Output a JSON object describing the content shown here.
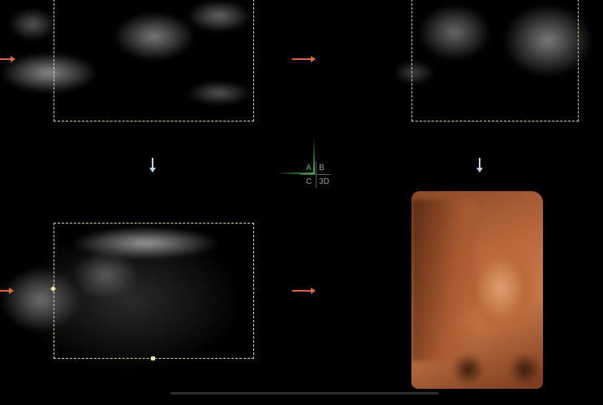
{
  "views": {
    "a_label": "A",
    "b_label": "B",
    "c_label": "C",
    "d_label": "3D"
  },
  "colors": {
    "active_axis": "#3fbf3f",
    "reference_arrow": "#d86a3a",
    "direction_arrow": "#bcd8f0",
    "roi_box": "#d8d49a",
    "render_tint": "#c0683a"
  }
}
